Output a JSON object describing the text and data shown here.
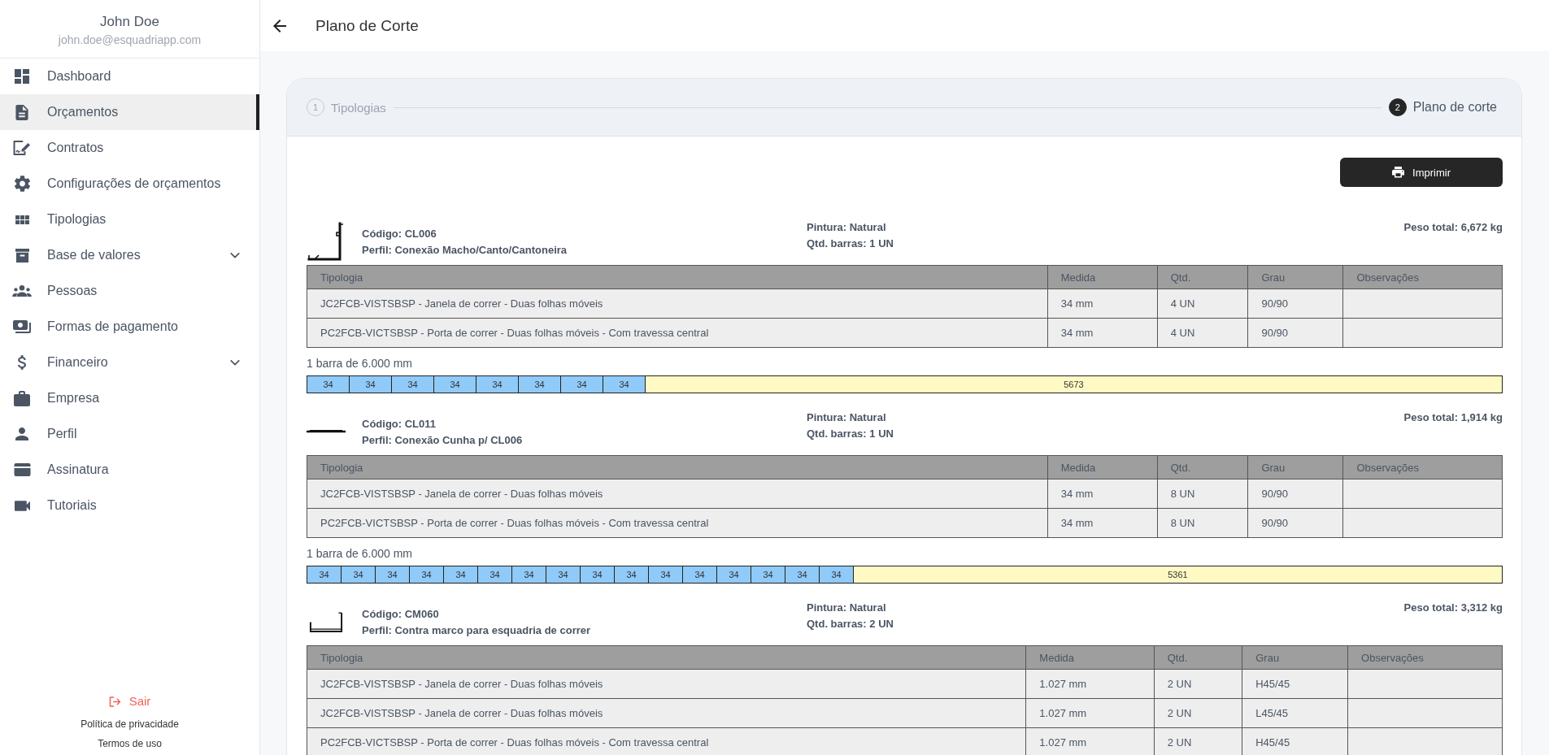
{
  "sidebar": {
    "user": {
      "name": "John Doe",
      "email": "john.doe@esquadriapp.com"
    },
    "items": [
      {
        "label": "Dashboard",
        "selected": false,
        "expandable": false
      },
      {
        "label": "Orçamentos",
        "selected": true,
        "expandable": false
      },
      {
        "label": "Contratos",
        "selected": false,
        "expandable": false
      },
      {
        "label": "Configurações de orçamentos",
        "selected": false,
        "expandable": false
      },
      {
        "label": "Tipologias",
        "selected": false,
        "expandable": false
      },
      {
        "label": "Base de valores",
        "selected": false,
        "expandable": true
      },
      {
        "label": "Pessoas",
        "selected": false,
        "expandable": false
      },
      {
        "label": "Formas de pagamento",
        "selected": false,
        "expandable": false
      },
      {
        "label": "Financeiro",
        "selected": false,
        "expandable": true
      },
      {
        "label": "Empresa",
        "selected": false,
        "expandable": false
      },
      {
        "label": "Perfil",
        "selected": false,
        "expandable": false
      },
      {
        "label": "Assinatura",
        "selected": false,
        "expandable": false
      },
      {
        "label": "Tutoriais",
        "selected": false,
        "expandable": false
      }
    ],
    "logout": "Sair",
    "links": [
      "Política de privacidade",
      "Termos de uso"
    ]
  },
  "header": {
    "title": "Plano de Corte"
  },
  "stepper": {
    "steps": [
      {
        "number": "1",
        "label": "Tipologias",
        "selected": false
      },
      {
        "number": "2",
        "label": "Plano de corte",
        "selected": true
      }
    ]
  },
  "print_button": "Imprimir",
  "profiles": [
    {
      "kind": "angle",
      "code": "Código: CL006",
      "profile": "Perfil: Conexão Macho/Canto/Cantoneira",
      "paint": "Pintura: Natural",
      "bar_quantity": "Qtd. barras: 1 UN",
      "total_weight": "Peso total: 6,672 kg",
      "table": {
        "columns": [
          "Tipologia",
          "Medida",
          "Qtd.",
          "Grau",
          "Observações"
        ],
        "rows": [
          {
            "cells": [
              "JC2FCB-VISTSBSP - Janela de correr - Duas folhas móveis",
              "34 mm",
              "4 UN",
              "90/90"
            ]
          },
          {
            "cells": [
              "PC2FCB-VICTSBSP - Porta de correr - Duas folhas móveis - Com travessa central",
              "34 mm",
              "4 UN",
              "90/90"
            ]
          }
        ]
      },
      "bars": [
        {
          "label": "1 barra de 6.000 mm",
          "pieces": [
            "34",
            "34",
            "34",
            "34",
            "34",
            "34",
            "34",
            "34"
          ],
          "remainder": "5673"
        }
      ]
    },
    {
      "kind": "strip",
      "code": "Código: CL011",
      "profile": "Perfil: Conexão Cunha p/ CL006",
      "paint": "Pintura: Natural",
      "bar_quantity": "Qtd. barras: 1 UN",
      "total_weight": "Peso total: 1,914 kg",
      "table": {
        "columns": [
          "Tipologia",
          "Medida",
          "Qtd.",
          "Grau",
          "Observações"
        ],
        "rows": [
          {
            "cells": [
              "JC2FCB-VISTSBSP - Janela de correr - Duas folhas móveis",
              "34 mm",
              "8 UN",
              "90/90"
            ]
          },
          {
            "cells": [
              "PC2FCB-VICTSBSP - Porta de correr - Duas folhas móveis - Com travessa central",
              "34 mm",
              "8 UN",
              "90/90"
            ]
          }
        ]
      },
      "bars": [
        {
          "label": "1 barra de 6.000 mm",
          "pieces": [
            "34",
            "34",
            "34",
            "34",
            "34",
            "34",
            "34",
            "34",
            "34",
            "34",
            "34",
            "34",
            "34",
            "34",
            "34",
            "34"
          ],
          "remainder": "5361"
        }
      ]
    },
    {
      "kind": "channel",
      "code": "Código: CM060",
      "profile": "Perfil: Contra marco para esquadria de correr",
      "paint": "Pintura: Natural",
      "bar_quantity": "Qtd. barras: 2 UN",
      "total_weight": "Peso total: 3,312 kg",
      "table": {
        "columns": [
          "Tipologia",
          "Medida",
          "Qtd.",
          "Grau",
          "Observações"
        ],
        "rows": [
          {
            "cells": [
              "JC2FCB-VISTSBSP - Janela de correr - Duas folhas móveis",
              "1.027 mm",
              "2 UN",
              "H45/45"
            ]
          },
          {
            "cells": [
              "JC2FCB-VISTSBSP - Janela de correr - Duas folhas móveis",
              "1.027 mm",
              "2 UN",
              "L45/45"
            ]
          },
          {
            "cells": [
              "PC2FCB-VICTSBSP - Porta de correr - Duas folhas móveis - Com travessa central",
              "1.027 mm",
              "2 UN",
              "H45/45"
            ]
          }
        ]
      }
    }
  ]
}
